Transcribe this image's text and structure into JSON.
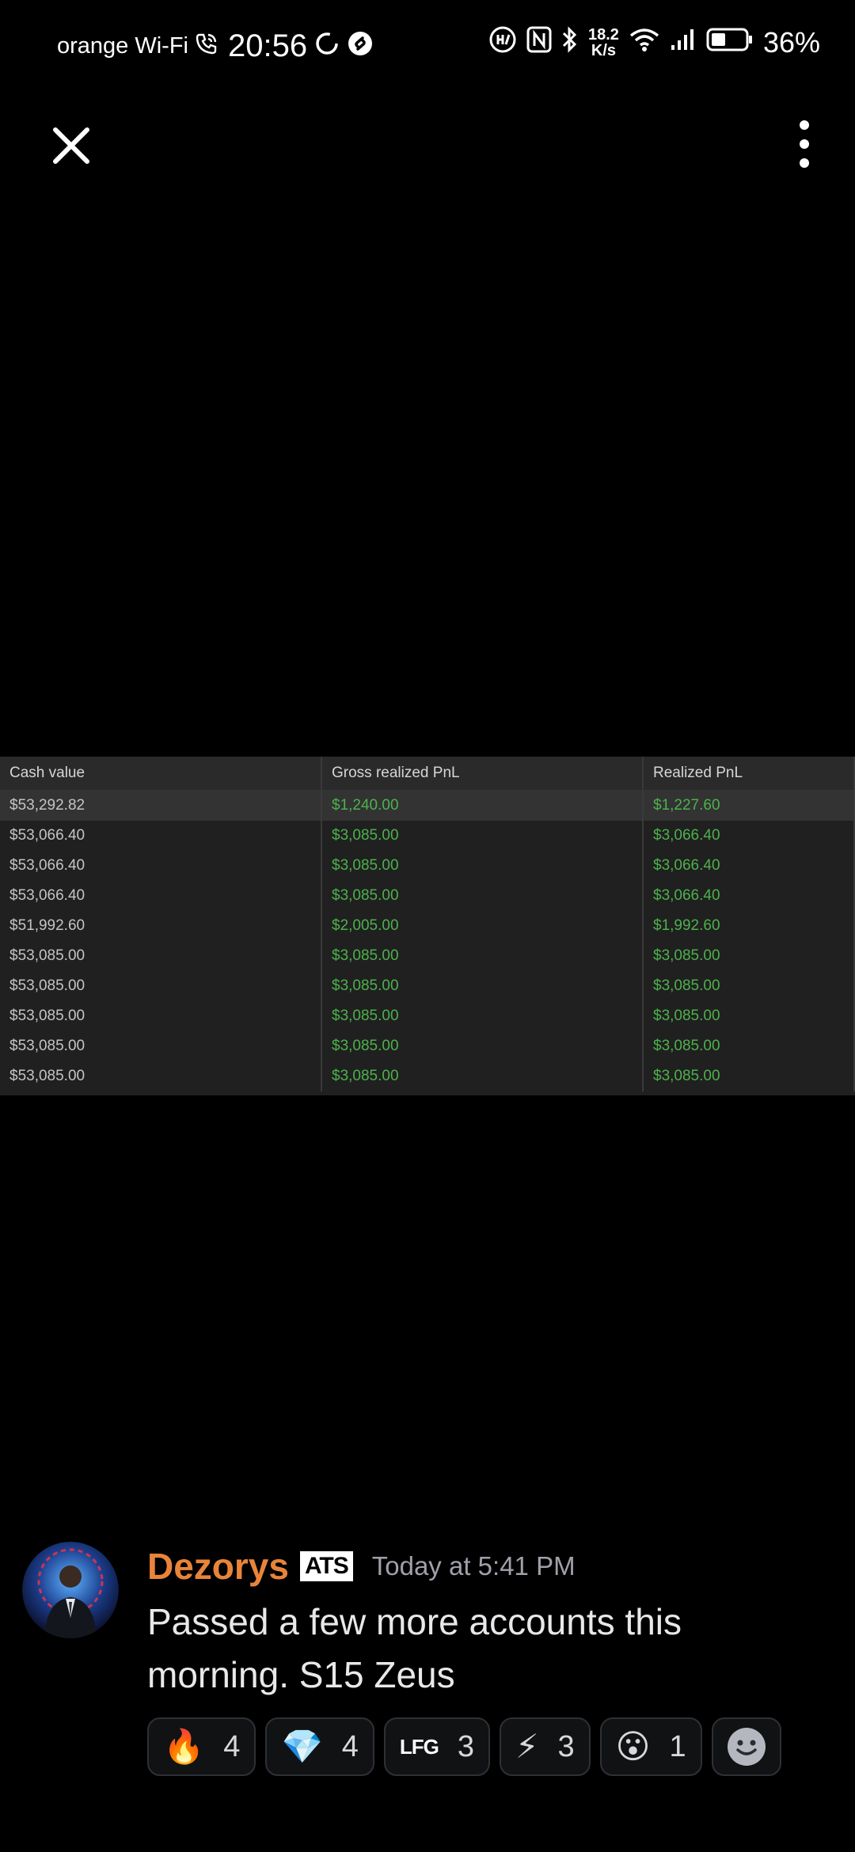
{
  "status_bar": {
    "carrier": "orange Wi-Fi",
    "time": "20:56",
    "network_speed_value": "18.2",
    "network_speed_unit": "K/s",
    "battery_percent": "36%"
  },
  "toolbar": {
    "close_icon": "close-icon",
    "more_icon": "more-vertical-icon"
  },
  "attachment": {
    "headers": [
      "Cash value",
      "Gross realized PnL",
      "Realized PnL"
    ],
    "rows": [
      [
        "$53,292.82",
        "$1,240.00",
        "$1,227.60"
      ],
      [
        "$53,066.40",
        "$3,085.00",
        "$3,066.40"
      ],
      [
        "$53,066.40",
        "$3,085.00",
        "$3,066.40"
      ],
      [
        "$53,066.40",
        "$3,085.00",
        "$3,066.40"
      ],
      [
        "$51,992.60",
        "$2,005.00",
        "$1,992.60"
      ],
      [
        "$53,085.00",
        "$3,085.00",
        "$3,085.00"
      ],
      [
        "$53,085.00",
        "$3,085.00",
        "$3,085.00"
      ],
      [
        "$53,085.00",
        "$3,085.00",
        "$3,085.00"
      ],
      [
        "$53,085.00",
        "$3,085.00",
        "$3,085.00"
      ],
      [
        "$53,085.00",
        "$3,085.00",
        "$3,085.00"
      ]
    ],
    "pnl_color": "#4cb24c"
  },
  "message": {
    "username": "Dezorys",
    "username_color": "#e8843a",
    "tag": "ATS",
    "timestamp": "Today at 5:41 PM",
    "text_line1": "Passed a few more accounts this",
    "text_line2": "morning. S15 Zeus"
  },
  "reactions": [
    {
      "emoji": "🔥",
      "count": "4",
      "icon": "fire-emoji"
    },
    {
      "emoji": "💎",
      "count": "4",
      "icon": "green-gem-emoji"
    },
    {
      "emoji": "LFG",
      "count": "3",
      "icon": "lfg-emoji"
    },
    {
      "emoji": "⚡",
      "count": "3",
      "icon": "lightning-emoji"
    },
    {
      "emoji": "😮",
      "count": "1",
      "icon": "surprised-face-emoji"
    }
  ]
}
